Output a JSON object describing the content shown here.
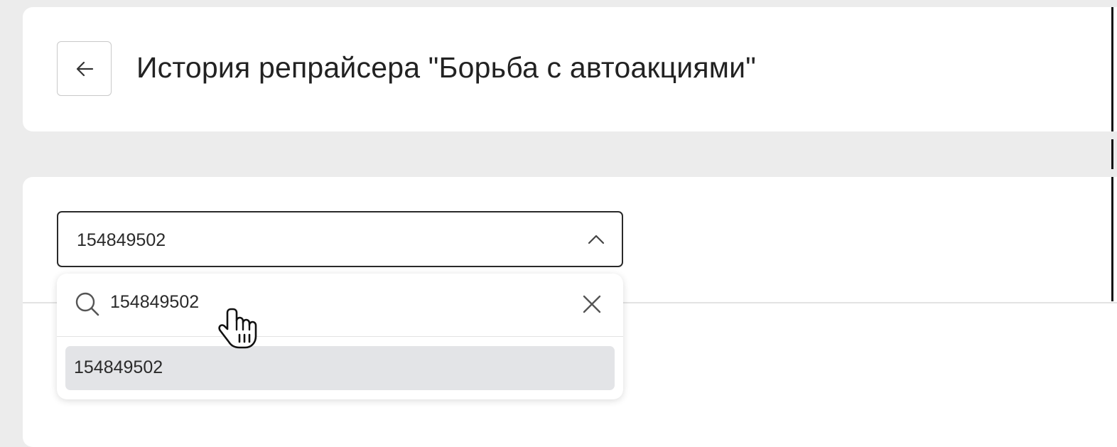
{
  "header": {
    "back_icon": "arrow-left-icon",
    "title": "История репрайсера \"Борьба с автоакциями\""
  },
  "select": {
    "value": "154849502",
    "icon": "chevron-up-icon",
    "expanded": true
  },
  "dropdown": {
    "search_icon": "search-icon",
    "search_value": "154849502",
    "clear_icon": "close-icon",
    "options": [
      {
        "label": "154849502",
        "highlighted": true
      }
    ]
  },
  "colors": {
    "background": "#ececec",
    "card": "#ffffff",
    "border_dark": "#2a2a2a",
    "option_highlight": "#e3e4e7"
  }
}
